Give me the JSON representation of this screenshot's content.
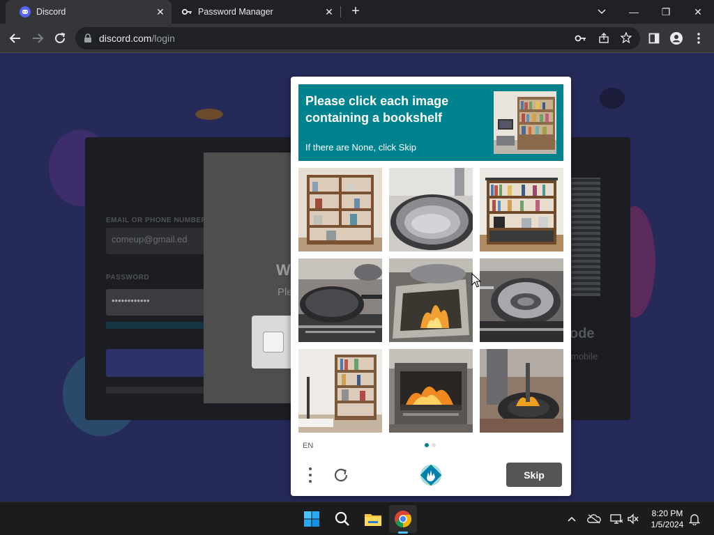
{
  "browser": {
    "tabs": [
      {
        "title": "Discord",
        "icon": "discord-icon",
        "active": true
      },
      {
        "title": "Password Manager",
        "icon": "key-icon",
        "active": false
      }
    ],
    "new_tab_label": "+",
    "address": {
      "domain": "discord.com",
      "path": "/login"
    },
    "window_controls": {
      "minimize": "—",
      "restore": "❐",
      "close": "✕"
    }
  },
  "discord_login": {
    "email_label": "EMAIL OR PHONE NUMBER",
    "email_value": "comeup@gmail.ed",
    "password_label": "PASSWORD",
    "password_value": "••••••••••••",
    "qr_title_fragment": "ode",
    "qr_sub_fragment": "mobile"
  },
  "hcaptcha_modal": {
    "heading_fragment": "W",
    "sub_fragment": "Ple"
  },
  "challenge": {
    "prompt": "Please click each image containing a bookshelf",
    "hint": "If there are None, click Skip",
    "language": "EN",
    "skip_label": "Skip",
    "pages": 2,
    "current_page": 1,
    "tiles": [
      {
        "content": "bookshelf"
      },
      {
        "content": "frying-pan"
      },
      {
        "content": "bookshelf"
      },
      {
        "content": "pan-on-stove"
      },
      {
        "content": "stove-fire"
      },
      {
        "content": "pan-on-stove"
      },
      {
        "content": "bookshelf-room"
      },
      {
        "content": "fireplace"
      },
      {
        "content": "burner"
      }
    ],
    "colors": {
      "prompt_bg": "#00838f",
      "skip_bg": "#555555"
    }
  },
  "taskbar": {
    "icons": [
      "windows-start-icon",
      "search-icon",
      "file-explorer-icon",
      "chrome-icon"
    ],
    "time": "8:20 PM",
    "date": "1/5/2024"
  }
}
